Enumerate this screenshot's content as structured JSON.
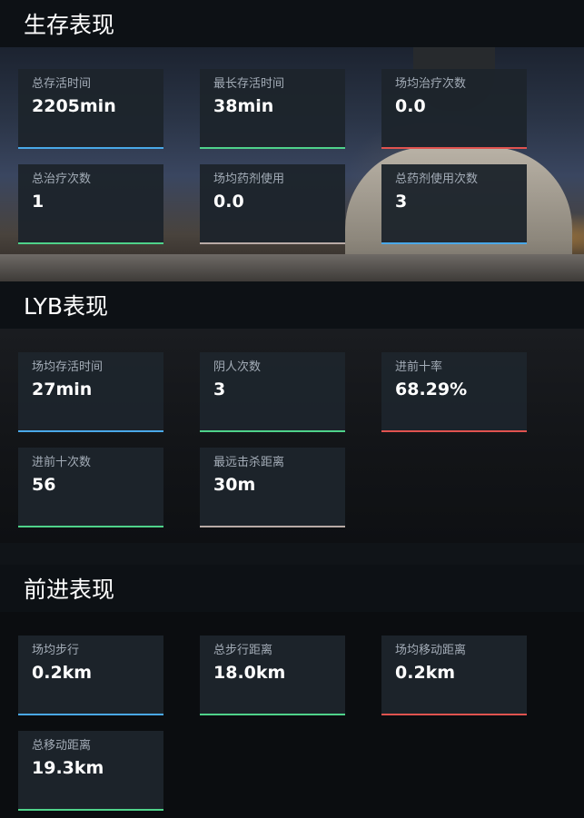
{
  "colors": {
    "blue": "#4aa8e8",
    "green": "#4fd28a",
    "red": "#e0534f",
    "grey": "#b8aaa6"
  },
  "sections": [
    {
      "title": "生存表现",
      "cards": [
        {
          "label": "总存活时间",
          "value": "2205min",
          "accent": "blue"
        },
        {
          "label": "最长存活时间",
          "value": "38min",
          "accent": "green"
        },
        {
          "label": "场均治疗次数",
          "value": "0.0",
          "accent": "red"
        },
        {
          "label": "总治疗次数",
          "value": "1",
          "accent": "green"
        },
        {
          "label": "场均药剂使用",
          "value": "0.0",
          "accent": "grey"
        },
        {
          "label": "总药剂使用次数",
          "value": "3",
          "accent": "blue"
        }
      ]
    },
    {
      "title": "LYB表现",
      "cards": [
        {
          "label": "场均存活时间",
          "value": "27min",
          "accent": "blue"
        },
        {
          "label": "阴人次数",
          "value": "3",
          "accent": "green"
        },
        {
          "label": "进前十率",
          "value": "68.29%",
          "accent": "red"
        },
        {
          "label": "进前十次数",
          "value": "56",
          "accent": "green"
        },
        {
          "label": "最远击杀距离",
          "value": "30m",
          "accent": "grey"
        }
      ]
    },
    {
      "title": "前进表现",
      "cards": [
        {
          "label": "场均步行",
          "value": "0.2km",
          "accent": "blue"
        },
        {
          "label": "总步行距离",
          "value": "18.0km",
          "accent": "green"
        },
        {
          "label": "场均移动距离",
          "value": "0.2km",
          "accent": "red"
        },
        {
          "label": "总移动距离",
          "value": "19.3km",
          "accent": "green"
        }
      ]
    }
  ]
}
